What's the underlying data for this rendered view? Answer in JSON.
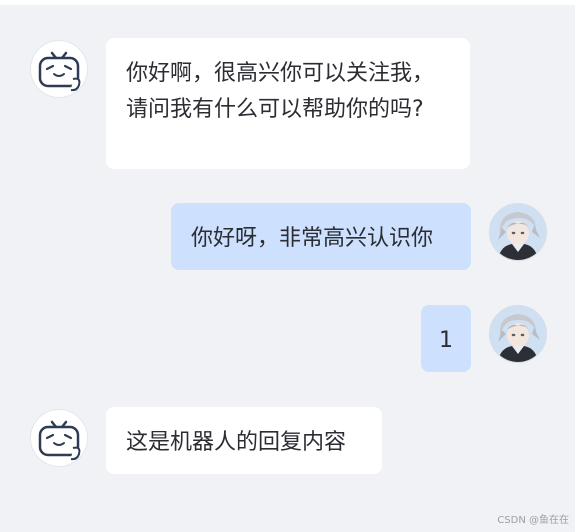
{
  "messages": [
    {
      "role": "bot",
      "text": "你好啊，很高兴你可以关注我，请问我有什么可以帮助你的吗?"
    },
    {
      "role": "user",
      "text": "你好呀，非常高兴认识你"
    },
    {
      "role": "user",
      "text": "1"
    },
    {
      "role": "bot",
      "text": "这是机器人的回复内容"
    }
  ],
  "watermark": "CSDN @鱼在在",
  "colors": {
    "background": "#f1f2f5",
    "bot_bubble": "#ffffff",
    "user_bubble": "#cde0fe",
    "text": "#2b2d33"
  },
  "icons": {
    "bot_avatar": "bilibili-tv-mascot-icon",
    "user_avatar": "anime-character-avatar"
  }
}
